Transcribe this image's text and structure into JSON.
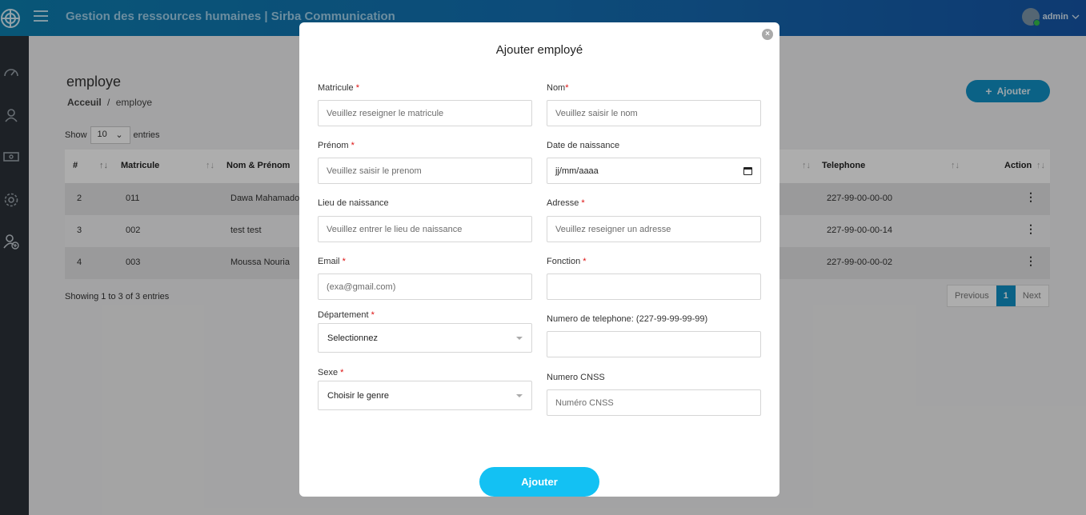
{
  "header": {
    "title": "Gestion des ressources humaines | Sirba Communication",
    "user": "admin"
  },
  "sidebar": {
    "icons": [
      "dashboard-icon",
      "user-icon",
      "money-icon",
      "settings-icon",
      "add-user-icon"
    ]
  },
  "page": {
    "title": "employe",
    "breadcrumb": {
      "home": "Acceuil",
      "sep": "/",
      "current": "employe"
    },
    "add_button": "Ajouter",
    "show_label": "Show",
    "entries_value": "10",
    "entries_label": "entries",
    "table": {
      "headers": {
        "num": "#",
        "matricule": "Matricule",
        "nom": "Nom & Prénom",
        "telephone": "Telephone",
        "action": "Action"
      },
      "rows": [
        {
          "num": "2",
          "matricule": "011",
          "nom": "Dawa Mahamado",
          "telephone": "227-99-00-00-00"
        },
        {
          "num": "3",
          "matricule": "002",
          "nom": "test test",
          "telephone": "227-99-00-00-14"
        },
        {
          "num": "4",
          "matricule": "003",
          "nom": "Moussa Nouria",
          "telephone": "227-99-00-00-02"
        }
      ]
    },
    "showing": "Showing 1 to 3 of 3 entries",
    "pager": {
      "prev": "Previous",
      "page": "1",
      "next": "Next"
    }
  },
  "modal": {
    "title": "Ajouter employé",
    "fields": {
      "matricule": {
        "label": "Matricule",
        "placeholder": "Veuillez reseigner le matricule"
      },
      "nom": {
        "label": "Nom",
        "placeholder": "Veuillez saisir le nom"
      },
      "prenom": {
        "label": "Prénom",
        "placeholder": "Veuillez saisir le prenom"
      },
      "date": {
        "label": "Date de naissance",
        "placeholder": "jj/mm/aaaa"
      },
      "lieu": {
        "label": "Lieu de naissance",
        "placeholder": "Veuillez entrer le lieu de naissance"
      },
      "adresse": {
        "label": "Adresse",
        "placeholder": "Veuillez reseigner un adresse"
      },
      "email": {
        "label": "Email",
        "placeholder": "(exa@gmail.com)"
      },
      "fonction": {
        "label": "Fonction",
        "placeholder": ""
      },
      "departement": {
        "label": "Département",
        "value": "Selectionnez"
      },
      "telephone": {
        "label": "Numero de telephone: (227-99-99-99-99)",
        "placeholder": ""
      },
      "sexe": {
        "label": "Sexe",
        "value": "Choisir le genre"
      },
      "cnss": {
        "label": "Numero CNSS",
        "placeholder": "Numéro CNSS"
      }
    },
    "required_mark": "*",
    "submit": "Ajouter",
    "close": "×"
  },
  "colors": {
    "brand": "#1470b4",
    "accent": "#13c1f3",
    "required": "#dd1111"
  }
}
